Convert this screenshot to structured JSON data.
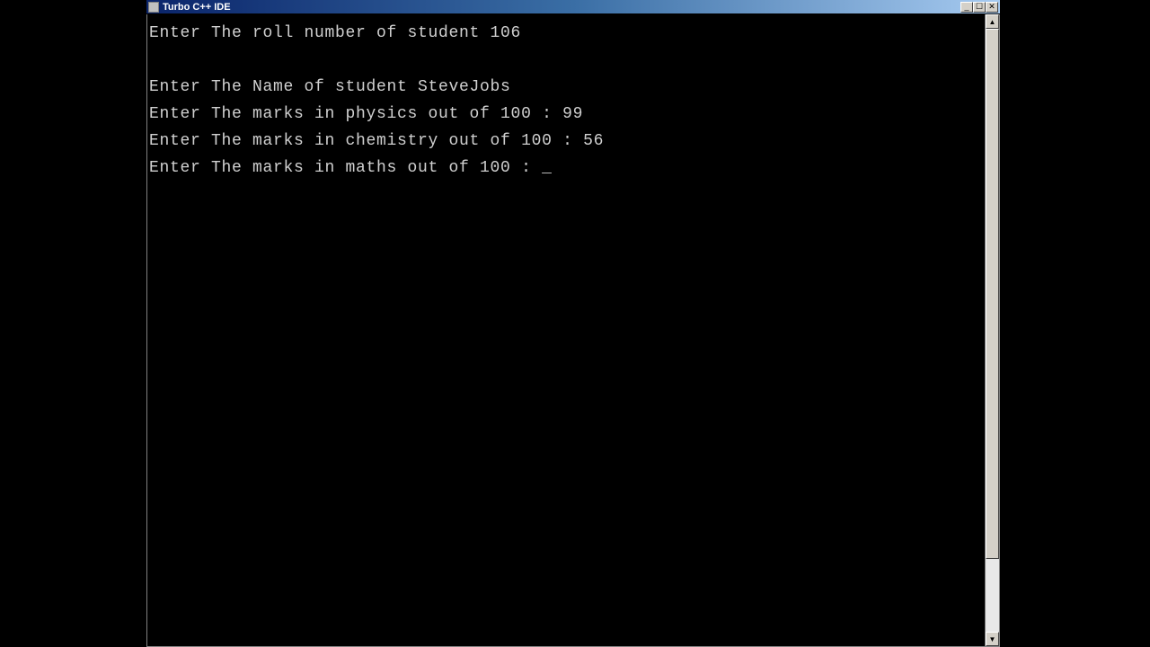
{
  "window": {
    "title": "Turbo C++ IDE"
  },
  "console": {
    "lines": [
      "Enter The roll number of student 106",
      "",
      "Enter The Name of student SteveJobs",
      "Enter The marks in physics out of 100 : 99",
      "Enter The marks in chemistry out of 100 : 56",
      "Enter The marks in maths out of 100 : "
    ],
    "cursor": "_"
  },
  "winbtns": {
    "minimize": "_",
    "maximize": "☐",
    "close": "✕"
  },
  "scroll": {
    "up": "▲",
    "down": "▼"
  }
}
